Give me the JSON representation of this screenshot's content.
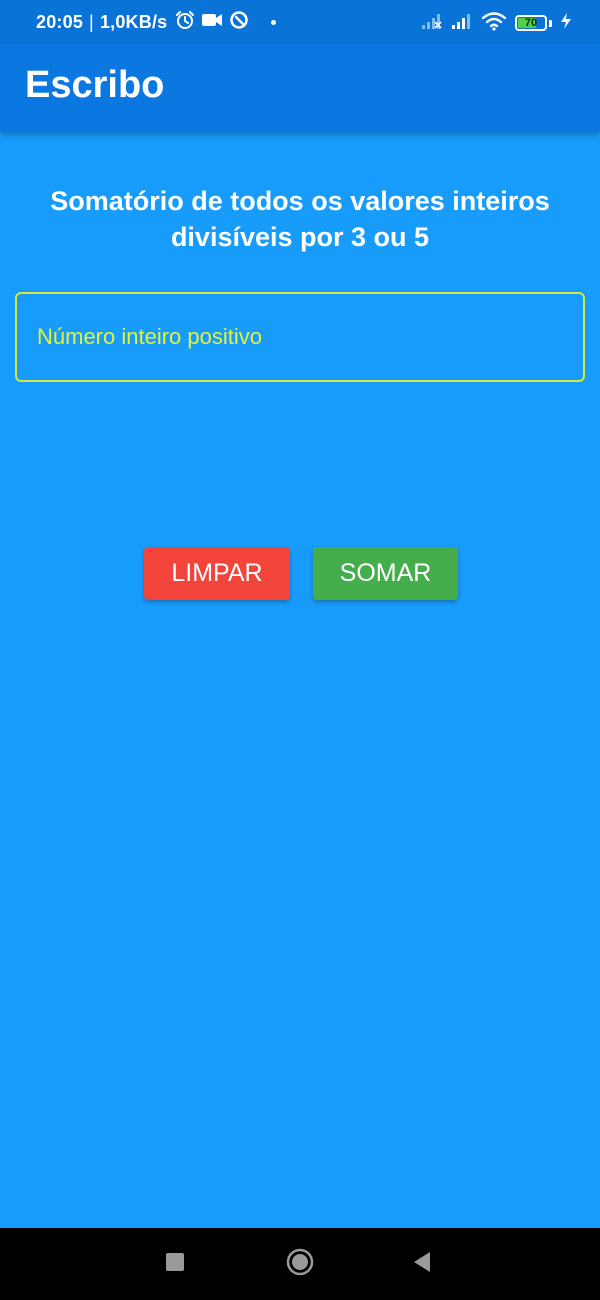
{
  "status_bar": {
    "time": "20:05",
    "separator": "|",
    "speed": "1,0KB/s",
    "battery_level": "70",
    "battery_fraction": 0.7,
    "icons": [
      "alarm-icon",
      "video-camera-icon",
      "data-saver-icon",
      "signal-off-icon",
      "signal-icon",
      "wifi-icon",
      "battery-icon",
      "charging-icon"
    ]
  },
  "app_bar": {
    "title": "Escribo"
  },
  "main": {
    "heading": "Somatório de todos os valores inteiros divisíveis por 3 ou 5",
    "input": {
      "placeholder": "Número inteiro positivo",
      "value": ""
    },
    "buttons": {
      "clear_label": "LIMPAR",
      "sum_label": "SOMAR"
    }
  },
  "colors": {
    "background": "#189cfb",
    "app_bar": "#0a78e0",
    "status_bar": "#0a73d8",
    "input_accent": "#e3f23a",
    "clear_button": "#f2443b",
    "sum_button": "#44ae4c"
  },
  "nav_bar": {
    "icons": [
      "recents-icon",
      "home-icon",
      "back-icon"
    ]
  }
}
